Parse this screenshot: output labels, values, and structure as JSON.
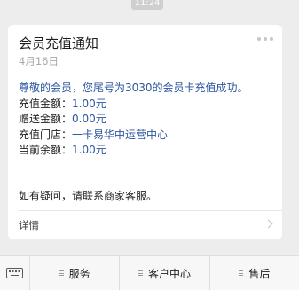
{
  "status": {
    "time": "11:24"
  },
  "card": {
    "title": "会员充值通知",
    "date": "4月16日",
    "intro": "尊敬的会员，您尾号为3030的会员卡充值成功。",
    "fields": [
      {
        "label": "充值金额：",
        "value": "1.00元"
      },
      {
        "label": "赠送金额：",
        "value": "0.00元"
      },
      {
        "label": "充值门店：",
        "value": "一卡易华中运营中心"
      },
      {
        "label": "当前余额：",
        "value": "1.00元"
      }
    ],
    "note": "如有疑问，请联系商家客服。",
    "detail_label": "详情"
  },
  "bottom_menu": {
    "items": [
      {
        "label": "服务"
      },
      {
        "label": "客户中心"
      },
      {
        "label": "售后"
      }
    ]
  }
}
